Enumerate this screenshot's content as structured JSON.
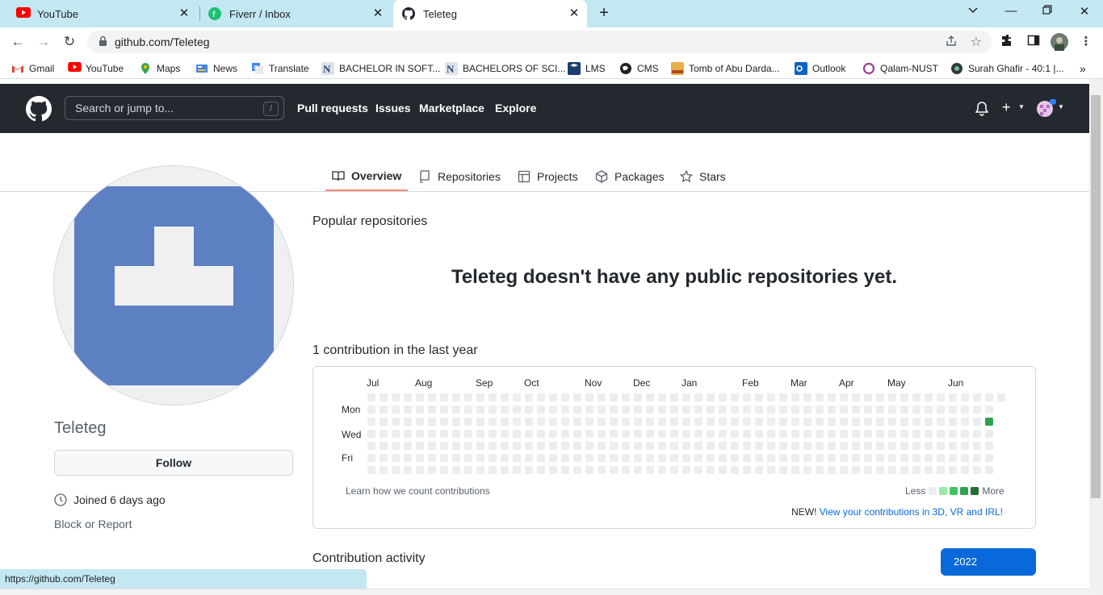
{
  "browser": {
    "tabs": [
      {
        "label": "YouTube",
        "icon": "youtube-icon",
        "active": false
      },
      {
        "label": "Fiverr / Inbox",
        "icon": "fiverr-icon",
        "active": false
      },
      {
        "label": "Teleteg",
        "icon": "github-icon",
        "active": true
      }
    ],
    "url": "github.com/Teleteg",
    "bookmarks": [
      {
        "label": "Gmail",
        "icon": "gmail-icon"
      },
      {
        "label": "YouTube",
        "icon": "youtube-icon"
      },
      {
        "label": "Maps",
        "icon": "maps-icon"
      },
      {
        "label": "News",
        "icon": "news-icon"
      },
      {
        "label": "Translate",
        "icon": "translate-icon"
      },
      {
        "label": "BACHELOR IN SOFT...",
        "icon": "nust-icon"
      },
      {
        "label": "BACHELORS OF SCI...",
        "icon": "nust-icon"
      },
      {
        "label": "LMS",
        "icon": "lms-icon"
      },
      {
        "label": "CMS",
        "icon": "globe-icon"
      },
      {
        "label": "Tomb of Abu Darda...",
        "icon": "islam-icon"
      },
      {
        "label": "Outlook",
        "icon": "outlook-icon"
      },
      {
        "label": "Qalam-NUST",
        "icon": "qalam-icon"
      },
      {
        "label": "Surah Ghafir - 40:1 |...",
        "icon": "quran-icon"
      }
    ],
    "status_url": "https://github.com/Teleteg"
  },
  "github": {
    "search_placeholder": "Search or jump to...",
    "search_shortcut": "/",
    "nav": [
      "Pull requests",
      "Issues",
      "Marketplace",
      "Explore"
    ]
  },
  "profile_tabs": [
    {
      "label": "Overview",
      "icon": "book-icon",
      "selected": true
    },
    {
      "label": "Repositories",
      "icon": "repo-icon",
      "selected": false
    },
    {
      "label": "Projects",
      "icon": "table-icon",
      "selected": false
    },
    {
      "label": "Packages",
      "icon": "package-icon",
      "selected": false
    },
    {
      "label": "Stars",
      "icon": "star-icon",
      "selected": false
    }
  ],
  "profile": {
    "username": "Teleteg",
    "follow_label": "Follow",
    "joined": "Joined 6 days ago",
    "block_label": "Block or Report"
  },
  "main": {
    "popular_title": "Popular repositories",
    "no_repos": "Teleteg doesn't have any public repositories yet.",
    "contrib_title": "1 contribution in the last year",
    "months": [
      "Jul",
      "Aug",
      "Sep",
      "Oct",
      "Nov",
      "Dec",
      "Jan",
      "Feb",
      "Mar",
      "Apr",
      "May",
      "Jun"
    ],
    "days": [
      "Mon",
      "Wed",
      "Fri"
    ],
    "learn_link": "Learn how we count contributions",
    "legend_less": "Less",
    "legend_more": "More",
    "new_prefix": "NEW!",
    "new_link": "View your contributions in 3D, VR and IRL!",
    "activity_title": "Contribution activity",
    "year": "2022",
    "colors": {
      "empty": "#ebedf0",
      "l1": "#9be9a8",
      "l2": "#40c463",
      "l3": "#30a14e",
      "l4": "#216e39"
    }
  }
}
